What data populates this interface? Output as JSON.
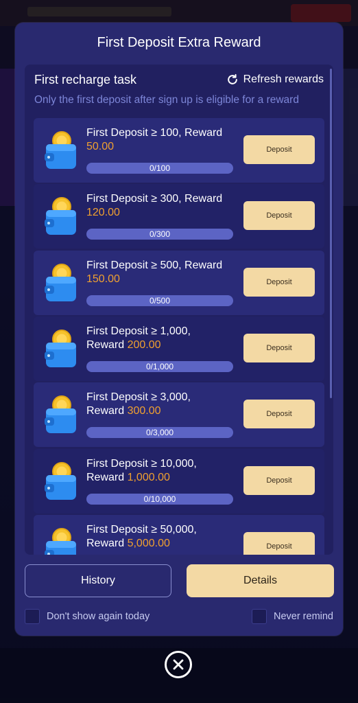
{
  "modal": {
    "title": "First Deposit Extra Reward",
    "task_header": "First recharge task",
    "refresh_label": "Refresh rewards",
    "eligibility_note": "Only the first deposit after sign up is eligible for a reward"
  },
  "tasks": [
    {
      "line1": "First Deposit ≥ 100, Reward",
      "line2_prefix": "",
      "reward": "50.00",
      "progress_label": "0/100",
      "progress": 0,
      "button": "Deposit"
    },
    {
      "line1": "First Deposit ≥ 300, Reward",
      "line2_prefix": "",
      "reward": "120.00",
      "progress_label": "0/300",
      "progress": 0,
      "button": "Deposit"
    },
    {
      "line1": "First Deposit ≥ 500, Reward",
      "line2_prefix": "",
      "reward": "150.00",
      "progress_label": "0/500",
      "progress": 0,
      "button": "Deposit"
    },
    {
      "line1": "First Deposit ≥ 1,000,",
      "line2_prefix": "Reward ",
      "reward": "200.00",
      "progress_label": "0/1,000",
      "progress": 0,
      "button": "Deposit"
    },
    {
      "line1": "First Deposit ≥ 3,000,",
      "line2_prefix": "Reward ",
      "reward": "300.00",
      "progress_label": "0/3,000",
      "progress": 0,
      "button": "Deposit"
    },
    {
      "line1": "First Deposit ≥ 10,000,",
      "line2_prefix": "Reward ",
      "reward": "1,000.00",
      "progress_label": "0/10,000",
      "progress": 0,
      "button": "Deposit"
    },
    {
      "line1": "First Deposit ≥ 50,000,",
      "line2_prefix": "Reward ",
      "reward": "5,000.00",
      "progress_label": "",
      "progress": 0,
      "button": "Deposit"
    }
  ],
  "footer": {
    "history_label": "History",
    "details_label": "Details",
    "dont_show_today": "Don't show again today",
    "never_remind": "Never remind"
  },
  "icons": {
    "refresh": "refresh-icon",
    "wallet": "wallet-coin-icon",
    "close": "close-circle-icon"
  },
  "colors": {
    "modal_bg": "#29296f",
    "panel_bg": "#212060",
    "reward_accent": "#f0a030",
    "button_bg": "#f3d9a4",
    "muted_text": "#7d86d8"
  }
}
